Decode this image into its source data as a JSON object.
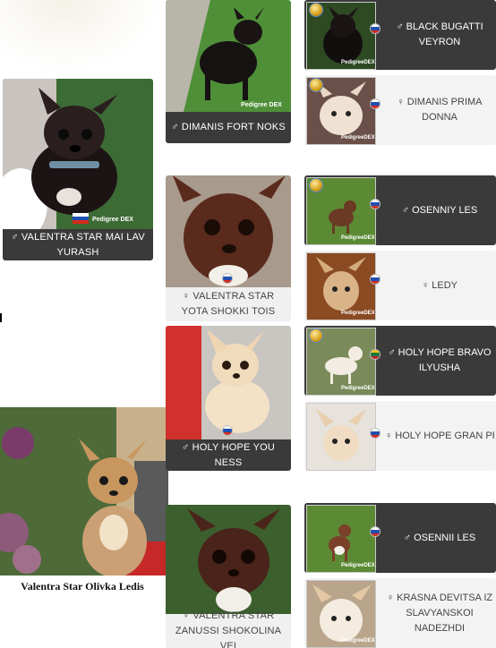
{
  "colors": {
    "dark": "#3a3a3a",
    "light": "#f3f3f3",
    "flag_white": "#ffffff",
    "flag_blue": "#1f4fb0",
    "flag_red": "#d52b1e"
  },
  "self": {
    "label": "♂ VALENTRA STAR MAI LAV YURASH",
    "watermark": "Pedigree DEX"
  },
  "dam": {
    "caption": "Valentra Star Olivka Ledis"
  },
  "parents": [
    {
      "label": "♂ DIMANIS FORT NOKS",
      "watermark": "Pedigree DEX"
    },
    {
      "label": "♀ VALENTRA STAR YOTA SHOKKI TOIS"
    },
    {
      "label": "♂ HOLY HOPE YOU NESS"
    },
    {
      "label": "♀ VALENTRA STAR ZANUSSI SHOKOLINA VEI"
    }
  ],
  "grandparents": [
    {
      "label": "♂ BLACK BUGATTI VEYRON",
      "watermark": "PedigreeDEX"
    },
    {
      "label": "♀ DIMANIS PRIMA DONNA",
      "watermark": "PedigreeDEX"
    },
    {
      "label": "♂ OSENNIY LES",
      "watermark": "PedigreeDEX"
    },
    {
      "label": "♀ LEDY",
      "watermark": "PedigreeDEX"
    },
    {
      "label": "♂ HOLY HOPE BRAVO ILYUSHA",
      "watermark": "PedigreeDEX"
    },
    {
      "label": "♀ HOLY HOPE GRAN PRI"
    },
    {
      "label": "♂ OSENNII LES",
      "watermark": "PedigreeDEX"
    },
    {
      "label": "♀ KRASNA DEVITSA IZ SLAVYANSKOI NADEZHDI",
      "watermark": "PedigreeDEX"
    }
  ]
}
